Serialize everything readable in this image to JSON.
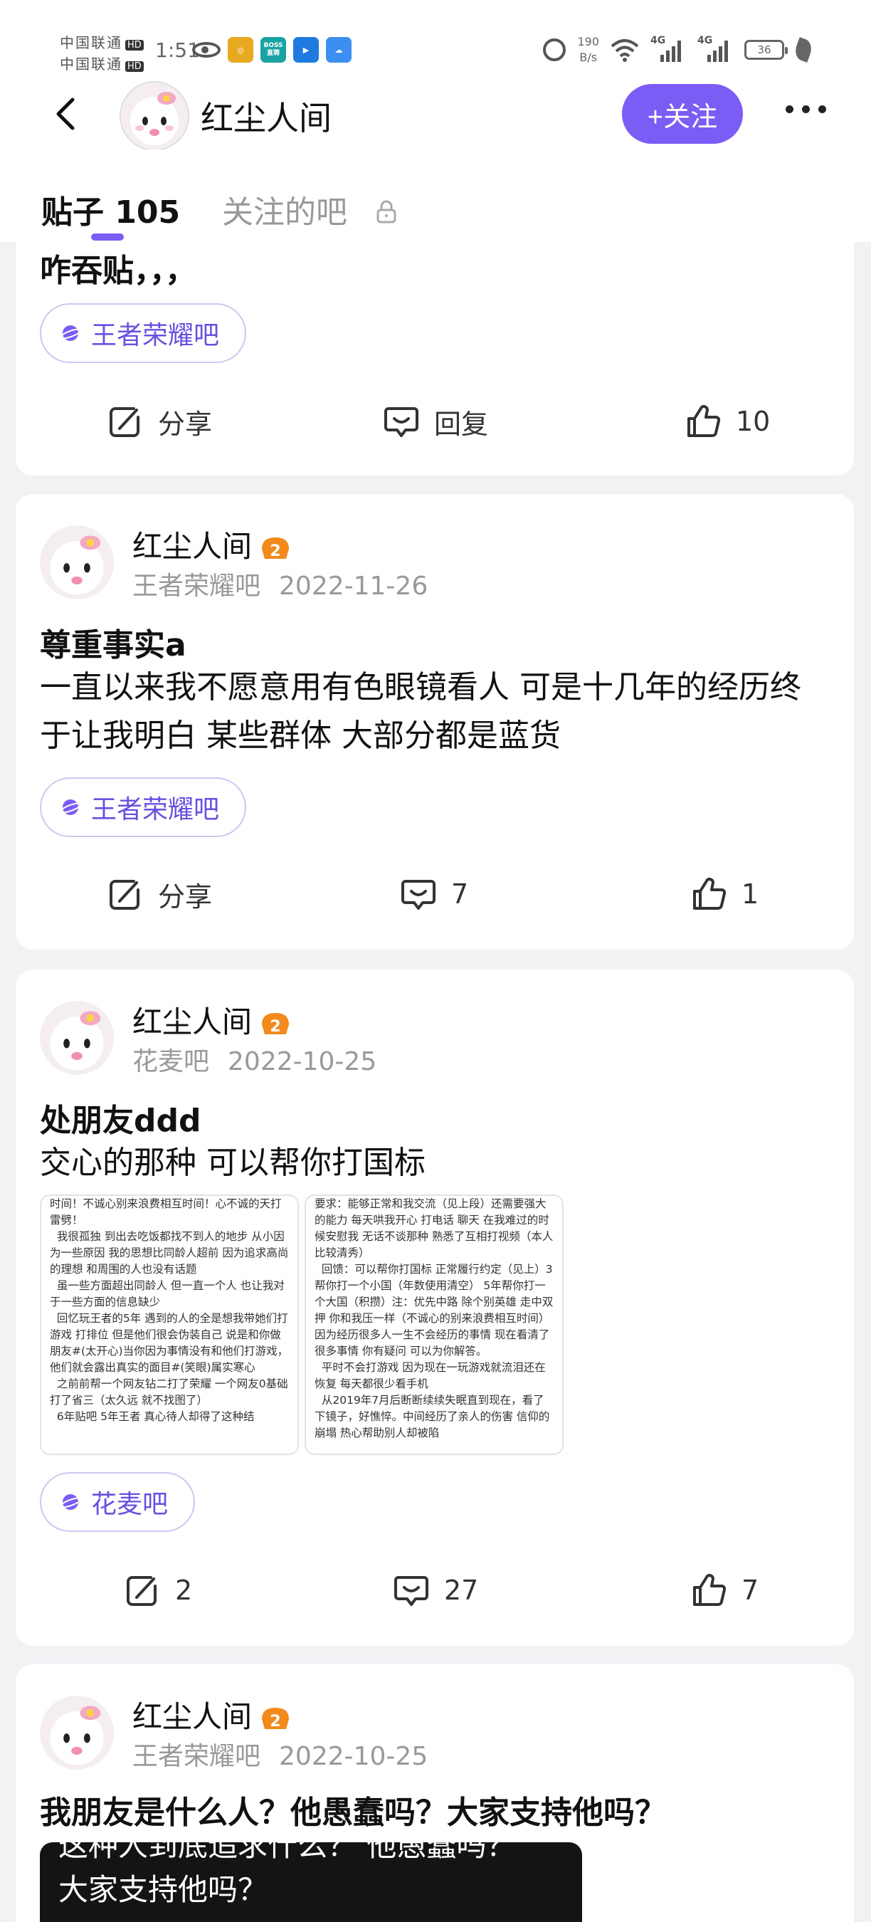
{
  "status_bar": {
    "carrier_1": "中国联通",
    "carrier_2": "中国联通",
    "hd": "HD",
    "time": "1:51",
    "boss_app": "BOSS直聘",
    "net_speed_value": "190",
    "net_speed_unit": "B/s",
    "signal_1": "4G",
    "signal_2": "4G",
    "battery": "36"
  },
  "header": {
    "user_name": "红尘人间",
    "follow_label": "+关注"
  },
  "tabs": {
    "posts_label": "贴子 105",
    "follow_label": "关注的吧"
  },
  "colors": {
    "accent": "#7b5cf5",
    "chip_text": "#6a4fe0"
  },
  "posts": [
    {
      "title": "咋吞贴，，，",
      "bar": "王者荣耀吧",
      "share_label": "分享",
      "reply_label": "回复",
      "likes": "10"
    },
    {
      "author": "红尘人间",
      "bar_name": "王者荣耀吧",
      "date": "2022-11-26",
      "title": "尊重事实a",
      "body": "一直以来我不愿意用有色眼镜看人 可是十几年的经历终于让我明白 某些群体 大部分都是蓝货",
      "bar": "王者荣耀吧",
      "share_label": "分享",
      "replies": "7",
      "likes": "1"
    },
    {
      "author": "红尘人间",
      "bar_name": "花麦吧",
      "date": "2022-10-25",
      "title": "处朋友ddd",
      "body": "交心的那种 可以帮你打国标",
      "image_1_text": "时间！不诚心别来浪费相互时间！心不诚的天打雷劈！\n  我很孤独 到出去吃饭都找不到人的地步 从小因为一些原因 我的思想比同龄人超前 因为追求高尚的理想 和周围的人也没有话题\n  虽一些方面超出同龄人 但一直一个人 也让我对于一些方面的信息缺少\n  回忆玩王者的5年 遇到的人的全是想我带她们打游戏 打排位 但是他们很会伪装自己 说是和你做朋友#(太开心)当你因为事情没有和他们打游戏，他们就会露出真实的面目#(笑眼)属实寒心\n  之前前帮一个网友钻二打了荣耀 一个网友0基础打了省三（太久远 就不找图了）\n  6年贴吧 5年王者 真心待人却得了这种结",
      "image_2_text": "要求：能够正常和我交流（见上段）还需要强大的能力 每天哄我开心 打电话 聊天 在我难过的时候安慰我 无话不谈那种 熟悉了互相打视频（本人比较清秀）\n  回馈：可以帮你打国标 正常履行约定（见上）3帮你打一个小国（年数使用清空） 5年帮你打一个大国（积攒）注：优先中路 除个别英雄 走中双押 你和我压一样（不诚心的别来浪费相互时间）因为经历很多人一生不会经历的事情 现在看清了很多事情 你有疑问 可以为你解答。\n  平时不会打游戏 因为现在一玩游戏就流泪还在恢复 每天都很少看手机\n  从2019年7月后断断续续失眠直到现在，看了下镜子，好憔悴。中间经历了亲人的伤害 信仰的崩塌 热心帮助别人却被陷",
      "bar": "花麦吧",
      "shares": "2",
      "replies": "27",
      "likes": "7"
    },
    {
      "author": "红尘人间",
      "bar_name": "王者荣耀吧",
      "date": "2022-10-25",
      "title": "我朋友是什么人？他愚蠢吗？大家支持他吗？",
      "image_text_1": "这种人到底追求什么？ 他愚蠢吗？",
      "image_text_2": "大家支持他吗？"
    }
  ]
}
